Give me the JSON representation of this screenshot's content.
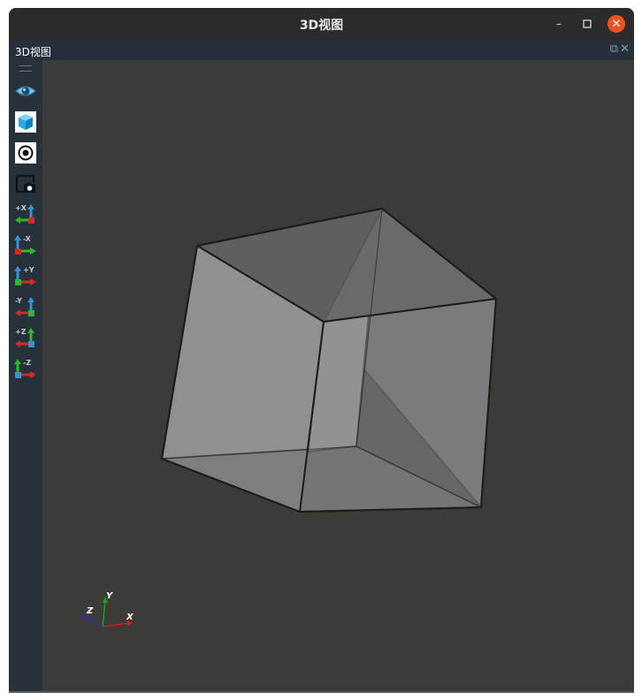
{
  "window": {
    "title": "3D视图",
    "controls": {
      "minimize": "–",
      "maximize": "□",
      "close": "✕"
    }
  },
  "panel": {
    "title": "3D视图",
    "float_icon": "⧉",
    "close_icon": "✕"
  },
  "toolbar": {
    "buttons": [
      {
        "name": "eye-icon",
        "label": ""
      },
      {
        "name": "shaded-cube-icon",
        "label": ""
      },
      {
        "name": "target-icon",
        "label": ""
      },
      {
        "name": "screenshot-icon",
        "label": ""
      },
      {
        "name": "view-plus-x-icon",
        "label": "+X"
      },
      {
        "name": "view-minus-x-icon",
        "label": "-X"
      },
      {
        "name": "view-plus-y-icon",
        "label": "+Y"
      },
      {
        "name": "view-minus-y-icon",
        "label": "-Y"
      },
      {
        "name": "view-plus-z-icon",
        "label": "+Z"
      },
      {
        "name": "view-minus-z-icon",
        "label": "-Z"
      }
    ]
  },
  "axes_gizmo": {
    "x": "X",
    "y": "Y",
    "z": "Z"
  },
  "colors": {
    "viewport_bg": "#3c3b38",
    "toolbar_bg": "#26313a",
    "close_button": "#e95420",
    "axis_x": "#d02020",
    "axis_y": "#20a020",
    "axis_z": "#2030c0"
  }
}
